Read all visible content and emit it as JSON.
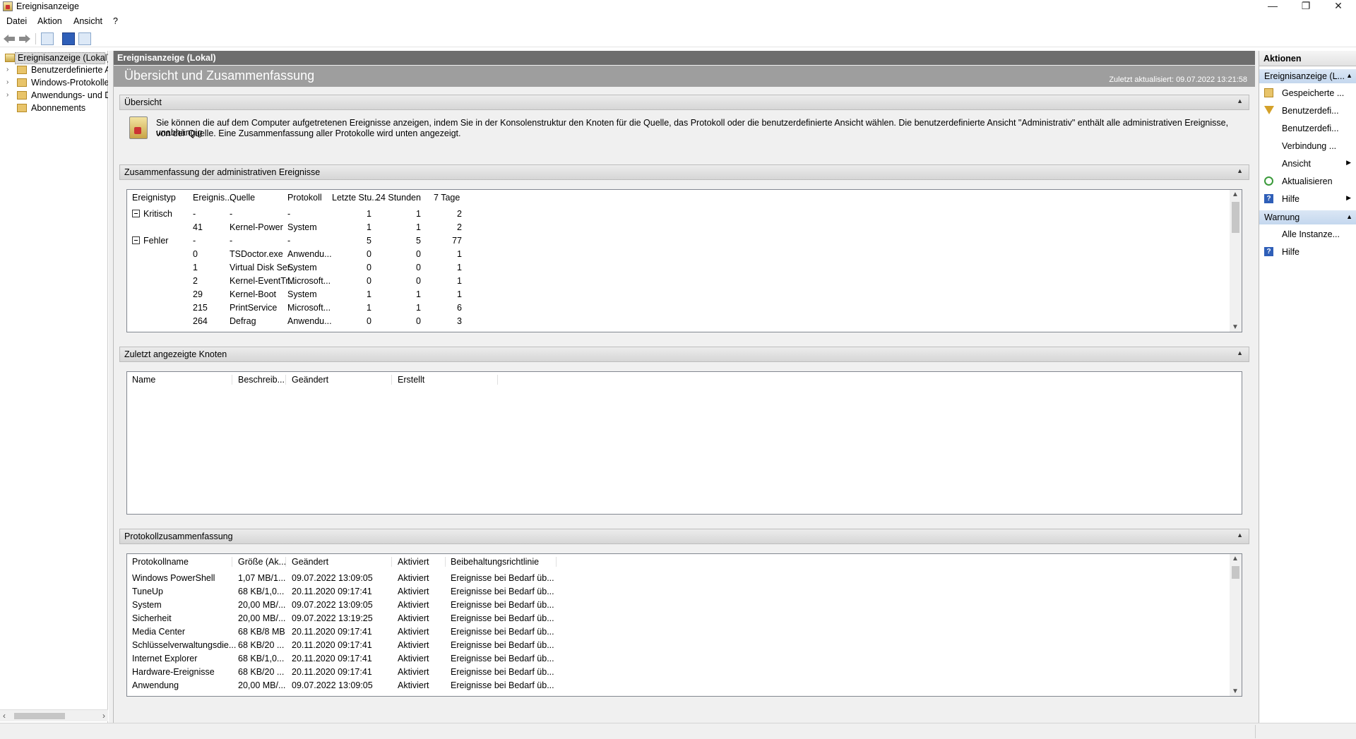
{
  "window": {
    "title": "Ereignisanzeige",
    "minimize": "—",
    "restore": "❐",
    "close": "✕"
  },
  "menu": {
    "items": [
      "Datei",
      "Aktion",
      "Ansicht",
      "?"
    ]
  },
  "tree": {
    "root": "Ereignisanzeige (Lokal)",
    "items": [
      {
        "label": "Benutzerdefinierte A",
        "expandable": true
      },
      {
        "label": "Windows-Protokolle",
        "expandable": true
      },
      {
        "label": "Anwendungs- und D",
        "expandable": true
      },
      {
        "label": "Abonnements",
        "expandable": false
      }
    ]
  },
  "center": {
    "header": "Ereignisanzeige (Lokal)",
    "banner_title": "Übersicht und Zusammenfassung",
    "last_updated": "Zuletzt aktualisiert: 09.07.2022 13:21:58",
    "overview": {
      "title": "Übersicht",
      "text_line1": "Sie können die auf dem Computer aufgetretenen Ereignisse anzeigen, indem Sie in der Konsolenstruktur den Knoten für die Quelle, das Protokoll oder die benutzerdefinierte Ansicht wählen. Die benutzerdefinierte Ansicht \"Administrativ\" enthält alle administrativen Ereignisse, unabhängig",
      "text_line2": "von der Quelle. Eine Zusammenfassung aller Protokolle wird unten angezeigt."
    },
    "admin_summary": {
      "title": "Zusammenfassung der administrativen Ereignisse",
      "columns": [
        "Ereignistyp",
        "Ereignis...",
        "Quelle",
        "Protokoll",
        "Letzte Stu...",
        "24 Stunden",
        "7 Tage"
      ],
      "rows": [
        {
          "type": "Kritisch",
          "group": true,
          "id": "-",
          "source": "-",
          "log": "-",
          "hour": "1",
          "day": "1",
          "week": "2"
        },
        {
          "type": "",
          "group": false,
          "id": "41",
          "source": "Kernel-Power",
          "log": "System",
          "hour": "1",
          "day": "1",
          "week": "2"
        },
        {
          "type": "Fehler",
          "group": true,
          "id": "-",
          "source": "-",
          "log": "-",
          "hour": "5",
          "day": "5",
          "week": "77"
        },
        {
          "type": "",
          "group": false,
          "id": "0",
          "source": "TSDoctor.exe",
          "log": "Anwendu...",
          "hour": "0",
          "day": "0",
          "week": "1"
        },
        {
          "type": "",
          "group": false,
          "id": "1",
          "source": "Virtual Disk Ser...",
          "log": "System",
          "hour": "0",
          "day": "0",
          "week": "1"
        },
        {
          "type": "",
          "group": false,
          "id": "2",
          "source": "Kernel-EventTr...",
          "log": "Microsoft...",
          "hour": "0",
          "day": "0",
          "week": "1"
        },
        {
          "type": "",
          "group": false,
          "id": "29",
          "source": "Kernel-Boot",
          "log": "System",
          "hour": "1",
          "day": "1",
          "week": "1"
        },
        {
          "type": "",
          "group": false,
          "id": "215",
          "source": "PrintService",
          "log": "Microsoft...",
          "hour": "1",
          "day": "1",
          "week": "6"
        },
        {
          "type": "",
          "group": false,
          "id": "264",
          "source": "Defrag",
          "log": "Anwendu...",
          "hour": "0",
          "day": "0",
          "week": "3"
        }
      ]
    },
    "recent_nodes": {
      "title": "Zuletzt angezeigte Knoten",
      "columns": [
        "Name",
        "Beschreib...",
        "Geändert",
        "Erstellt"
      ]
    },
    "log_summary": {
      "title": "Protokollzusammenfassung",
      "columns": [
        "Protokollname",
        "Größe (Ak...",
        "Geändert",
        "Aktiviert",
        "Beibehaltungsrichtlinie"
      ],
      "rows": [
        {
          "name": "Windows PowerShell",
          "size": "1,07 MB/1...",
          "changed": "09.07.2022 13:09:05",
          "enabled": "Aktiviert",
          "policy": "Ereignisse bei Bedarf üb..."
        },
        {
          "name": "TuneUp",
          "size": "68 KB/1,0...",
          "changed": "20.11.2020 09:17:41",
          "enabled": "Aktiviert",
          "policy": "Ereignisse bei Bedarf üb..."
        },
        {
          "name": "System",
          "size": "20,00 MB/...",
          "changed": "09.07.2022 13:09:05",
          "enabled": "Aktiviert",
          "policy": "Ereignisse bei Bedarf üb..."
        },
        {
          "name": "Sicherheit",
          "size": "20,00 MB/...",
          "changed": "09.07.2022 13:19:25",
          "enabled": "Aktiviert",
          "policy": "Ereignisse bei Bedarf üb..."
        },
        {
          "name": "Media Center",
          "size": "68 KB/8 MB",
          "changed": "20.11.2020 09:17:41",
          "enabled": "Aktiviert",
          "policy": "Ereignisse bei Bedarf üb..."
        },
        {
          "name": "Schlüsselverwaltungsdie...",
          "size": "68 KB/20 ...",
          "changed": "20.11.2020 09:17:41",
          "enabled": "Aktiviert",
          "policy": "Ereignisse bei Bedarf üb..."
        },
        {
          "name": "Internet Explorer",
          "size": "68 KB/1,0...",
          "changed": "20.11.2020 09:17:41",
          "enabled": "Aktiviert",
          "policy": "Ereignisse bei Bedarf üb..."
        },
        {
          "name": "Hardware-Ereignisse",
          "size": "68 KB/20 ...",
          "changed": "20.11.2020 09:17:41",
          "enabled": "Aktiviert",
          "policy": "Ereignisse bei Bedarf üb..."
        },
        {
          "name": "Anwendung",
          "size": "20,00 MB/...",
          "changed": "09.07.2022 13:09:05",
          "enabled": "Aktiviert",
          "policy": "Ereignisse bei Bedarf üb..."
        }
      ]
    }
  },
  "actions": {
    "title": "Aktionen",
    "group1": "Ereignisanzeige (L...",
    "items1": [
      {
        "label": "Gespeicherte ...",
        "icon": "folder-icon",
        "submenu": false
      },
      {
        "label": "Benutzerdefi...",
        "icon": "filter-icon",
        "submenu": false
      },
      {
        "label": "Benutzerdefi...",
        "icon": "",
        "submenu": false
      },
      {
        "label": "Verbindung ...",
        "icon": "",
        "submenu": false
      },
      {
        "label": "Ansicht",
        "icon": "",
        "submenu": true
      },
      {
        "label": "Aktualisieren",
        "icon": "refresh-icon",
        "submenu": false
      },
      {
        "label": "Hilfe",
        "icon": "help-icon",
        "submenu": true
      }
    ],
    "group2": "Warnung",
    "items2": [
      {
        "label": "Alle Instanze...",
        "icon": "",
        "submenu": false
      },
      {
        "label": "Hilfe",
        "icon": "help-icon",
        "submenu": false
      }
    ]
  },
  "colors": {
    "center_header": "#6d6d6d",
    "banner": "#9e9e9e",
    "action_group": "#c4d7ee"
  }
}
